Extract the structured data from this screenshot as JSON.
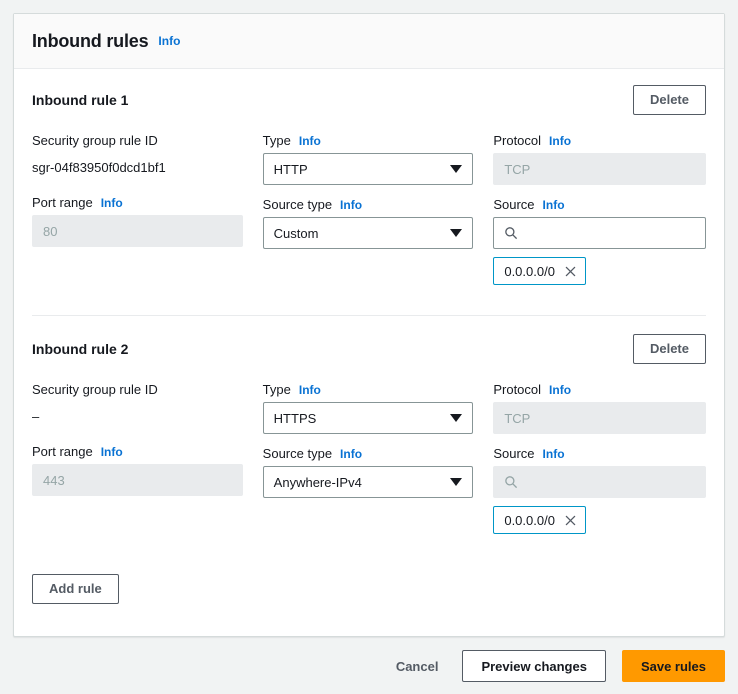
{
  "colors": {
    "accent_blue": "#0972d3",
    "token_border": "#0096c7",
    "primary_orange": "#ff9900",
    "page_bg": "#f1f3f3",
    "card_bg": "#ffffff",
    "disabled_bg": "#e9ebed"
  },
  "panel": {
    "title": "Inbound rules",
    "info_label": "Info"
  },
  "labels": {
    "security_group_rule_id": "Security group rule ID",
    "port_range": "Port range",
    "type": "Type",
    "source_type": "Source type",
    "protocol": "Protocol",
    "source": "Source",
    "info": "Info",
    "delete": "Delete"
  },
  "rules": [
    {
      "title": "Inbound rule 1",
      "delete_label": "Delete",
      "rule_id": "sgr-04f83950f0dcd1bf1",
      "port_range_value": "80",
      "port_range_disabled": true,
      "type_value": "HTTP",
      "source_type_value": "Custom",
      "protocol_value": "TCP",
      "protocol_disabled": true,
      "source_placeholder": "",
      "source_disabled": false,
      "source_tokens": [
        "0.0.0.0/0"
      ]
    },
    {
      "title": "Inbound rule 2",
      "delete_label": "Delete",
      "rule_id": "–",
      "port_range_value": "443",
      "port_range_disabled": true,
      "type_value": "HTTPS",
      "source_type_value": "Anywhere-IPv4",
      "protocol_value": "TCP",
      "protocol_disabled": true,
      "source_placeholder": "",
      "source_disabled": true,
      "source_tokens": [
        "0.0.0.0/0"
      ]
    }
  ],
  "add_rule": {
    "label": "Add rule"
  },
  "footer": {
    "cancel_label": "Cancel",
    "preview_label": "Preview changes",
    "save_label": "Save rules"
  }
}
